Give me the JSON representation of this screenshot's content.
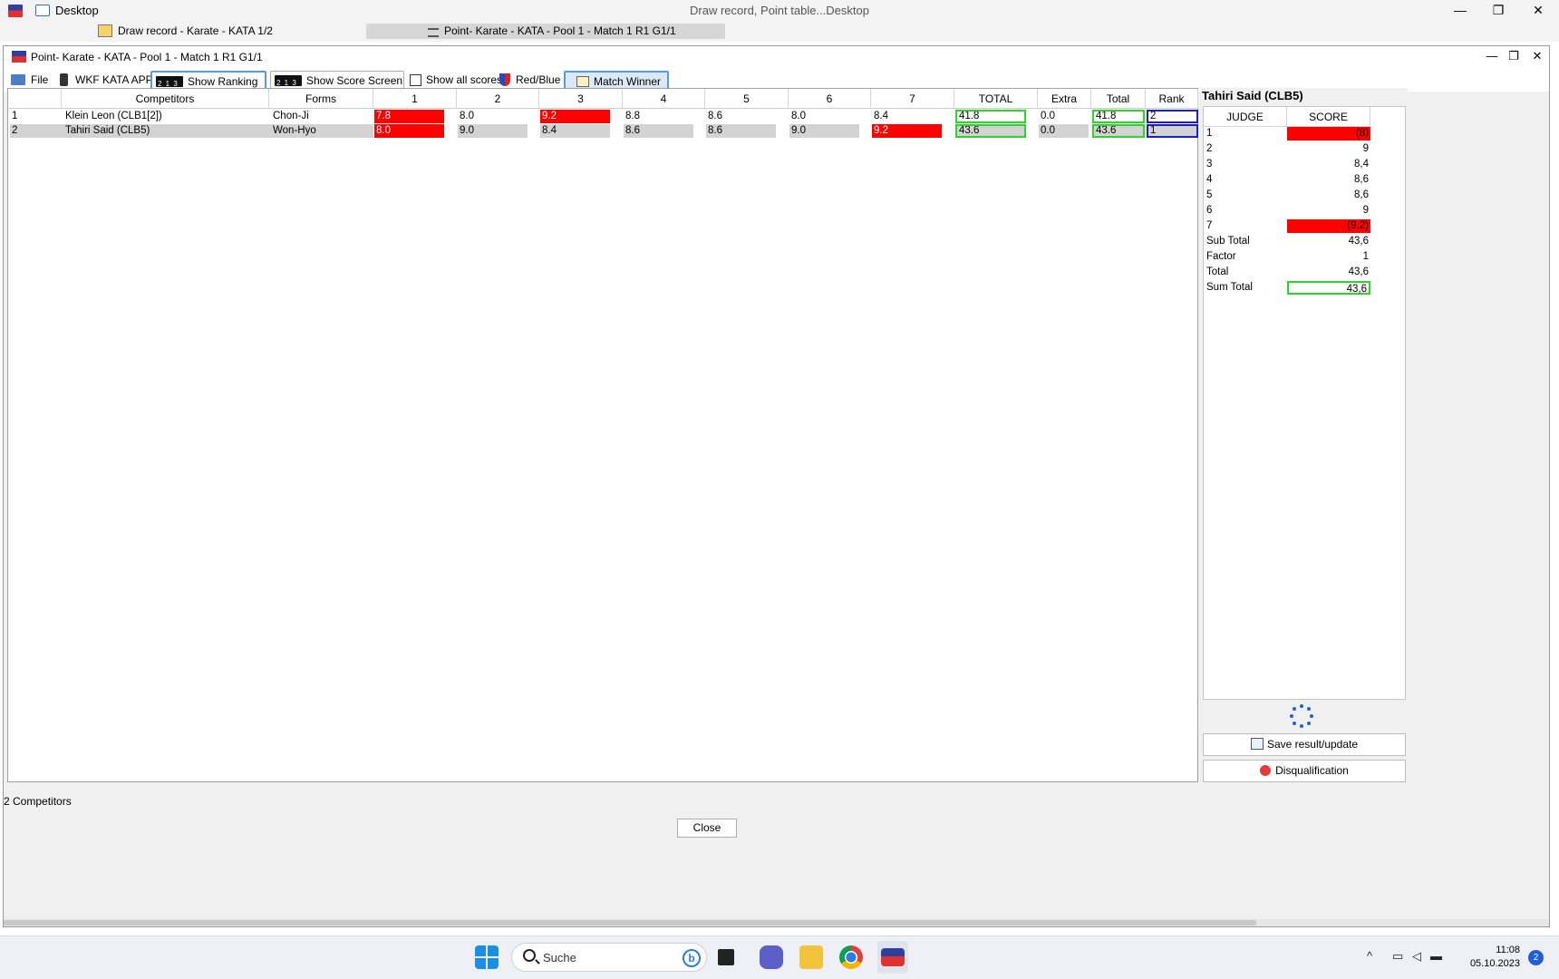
{
  "app": {
    "title_center": "Draw record, Point table...Desktop",
    "desktop_label": "Desktop",
    "minimize": "—",
    "restore": "❐",
    "close": "✕"
  },
  "mdi_tabs": [
    {
      "label": "Draw record - Karate - KATA 1/2"
    },
    {
      "label": "Point- Karate - KATA - Pool 1 - Match 1 R1 G1/1"
    }
  ],
  "window": {
    "title": "Point- Karate - KATA - Pool 1 - Match 1 R1 G1/1",
    "min": "—",
    "restore": "❐",
    "close": "✕"
  },
  "toolbar": {
    "file": "File",
    "wkf_app": "WKF KATA APP",
    "show_ranking": "Show Ranking",
    "show_score_screen": "Show Score Screen",
    "show_all_scores": "Show all scores",
    "red_blue": "Red/Blue",
    "match_winner": "Match Winner"
  },
  "grid": {
    "columns": [
      "",
      "Competitors",
      "Forms",
      "1",
      "2",
      "3",
      "4",
      "5",
      "6",
      "7",
      "TOTAL",
      "Extra",
      "Total",
      "Rank"
    ],
    "rows": [
      {
        "no": "1",
        "competitor": "Klein Leon (CLB1[2])",
        "form": "Chon-Ji",
        "scores": [
          "7.8",
          "8.0",
          "9.2",
          "8.8",
          "8.6",
          "8.0",
          "8.4"
        ],
        "total": "41.8",
        "extra": "0.0",
        "total2": "41.8",
        "rank": "2"
      },
      {
        "no": "2",
        "competitor": "Tahiri Said (CLB5)",
        "form": "Won-Hyo",
        "scores": [
          "8.0",
          "9.0",
          "8.4",
          "8.6",
          "8.6",
          "9.0",
          "9.2"
        ],
        "total": "43.6",
        "extra": "0.0",
        "total2": "43.6",
        "rank": "1"
      }
    ]
  },
  "panel": {
    "title": "Tahiri Said (CLB5)",
    "col_judge": "JUDGE",
    "col_score": "SCORE",
    "judges": [
      {
        "label": "1",
        "value": "(8)"
      },
      {
        "label": "2",
        "value": "9"
      },
      {
        "label": "3",
        "value": "8,4"
      },
      {
        "label": "4",
        "value": "8,6"
      },
      {
        "label": "5",
        "value": "8,6"
      },
      {
        "label": "6",
        "value": "9"
      },
      {
        "label": "7",
        "value": "(9,2)"
      }
    ],
    "summary": [
      {
        "label": "Sub Total",
        "value": "43,6"
      },
      {
        "label": "Factor",
        "value": "1"
      },
      {
        "label": "Total",
        "value": "43,6"
      },
      {
        "label": "Sum Total",
        "value": "43,6"
      }
    ],
    "save_button": "Save result/update",
    "disqualification_button": "Disqualification"
  },
  "status": "2 Competitors",
  "close_button": "Close",
  "taskbar": {
    "search_placeholder": "Suche",
    "time": "11:08",
    "date": "05.10.2023",
    "notifications": "2"
  },
  "colors": {
    "discarded_score": "#ff0000",
    "total_highlight": "#2bd62b",
    "rank_highlight": "#1b1bd0",
    "selected_row": "#d3d3d3"
  }
}
